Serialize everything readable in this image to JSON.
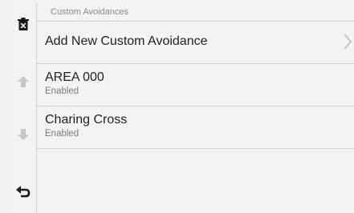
{
  "header": {
    "title": "Custom Avoidances"
  },
  "list": {
    "items": [
      {
        "title": "Add New Custom Avoidance",
        "subtitle": ""
      },
      {
        "title": "AREA 000",
        "subtitle": "Enabled"
      },
      {
        "title": "Charing Cross",
        "subtitle": "Enabled"
      }
    ]
  },
  "sidebar": {
    "icons": [
      "trash-icon",
      "arrow-up-icon",
      "arrow-down-icon",
      "back-icon"
    ]
  },
  "colors": {
    "background": "#f3f3f3",
    "divider": "#d2d2d2",
    "icon_active": "#1a1a1a",
    "icon_disabled": "#c6c6c6"
  }
}
